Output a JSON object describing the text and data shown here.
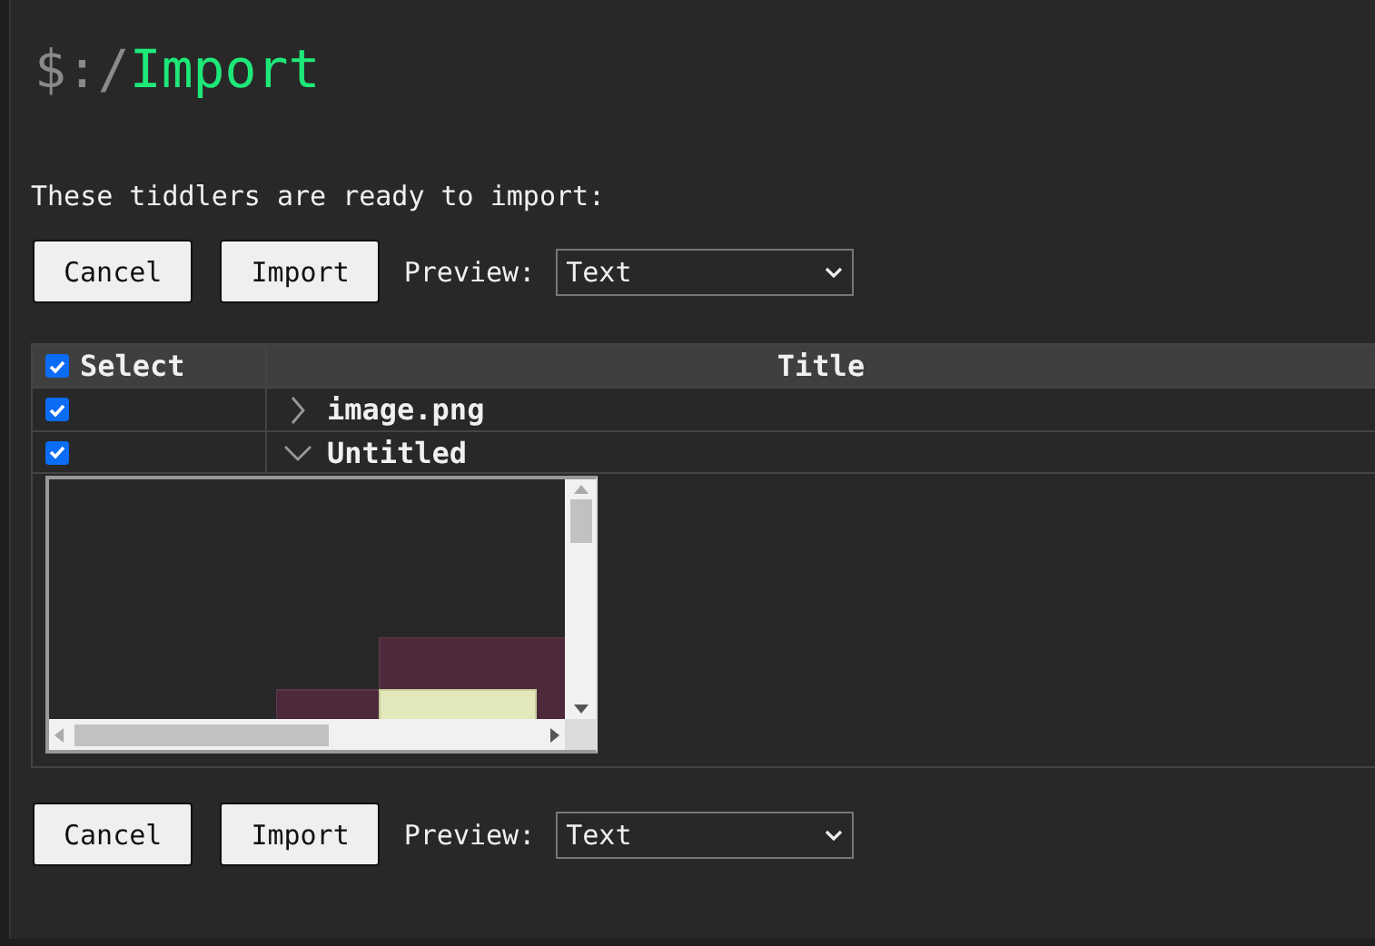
{
  "heading": {
    "prefix": "$:/",
    "name": "Import"
  },
  "intro": "These tiddlers are ready to import:",
  "toolbars": [
    {
      "buttons": [
        "Cancel",
        "Import"
      ],
      "preview_label": "Preview:",
      "preview_value": "Text"
    },
    {
      "buttons": [
        "Cancel",
        "Import"
      ],
      "preview_label": "Preview:",
      "preview_value": "Text"
    }
  ],
  "table": {
    "select_column": {
      "label": "Select",
      "checked": true
    },
    "title_column": {
      "label": "Title"
    },
    "rows": [
      {
        "checked": true,
        "title": "image.png",
        "expanded": false
      },
      {
        "checked": true,
        "title": "Untitled",
        "expanded": true
      }
    ]
  }
}
